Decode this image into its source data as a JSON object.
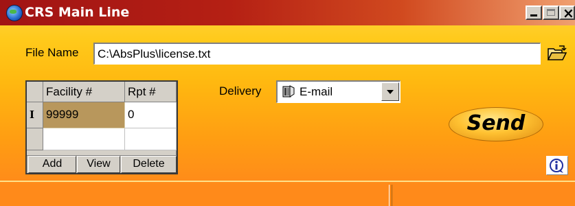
{
  "window": {
    "title": "CRS Main Line"
  },
  "file": {
    "label": "File Name",
    "value": "C:\\AbsPlus\\license.txt"
  },
  "grid": {
    "columns": [
      "Facility #",
      "Rpt #"
    ],
    "rows": [
      {
        "marker": "I",
        "facility": "99999",
        "rpt": "0"
      },
      {
        "marker": "",
        "facility": "",
        "rpt": ""
      }
    ],
    "buttons": {
      "add": "Add",
      "view": "View",
      "delete": "Delete"
    }
  },
  "delivery": {
    "label": "Delivery",
    "selected": "E-mail"
  },
  "send": {
    "label": "Send"
  },
  "status": {
    "left": "",
    "right": ""
  },
  "colors": {
    "title_bar": "#a11414",
    "window_bg_top": "#ffd640",
    "window_bg_bottom": "#ff8a1a",
    "selected_cell": "#b8975c",
    "send_button": "#ffc232"
  },
  "icons": {
    "app": "globe-icon",
    "folder": "open-folder-icon",
    "delivery": "mail-device-icon",
    "info": "info-icon"
  }
}
